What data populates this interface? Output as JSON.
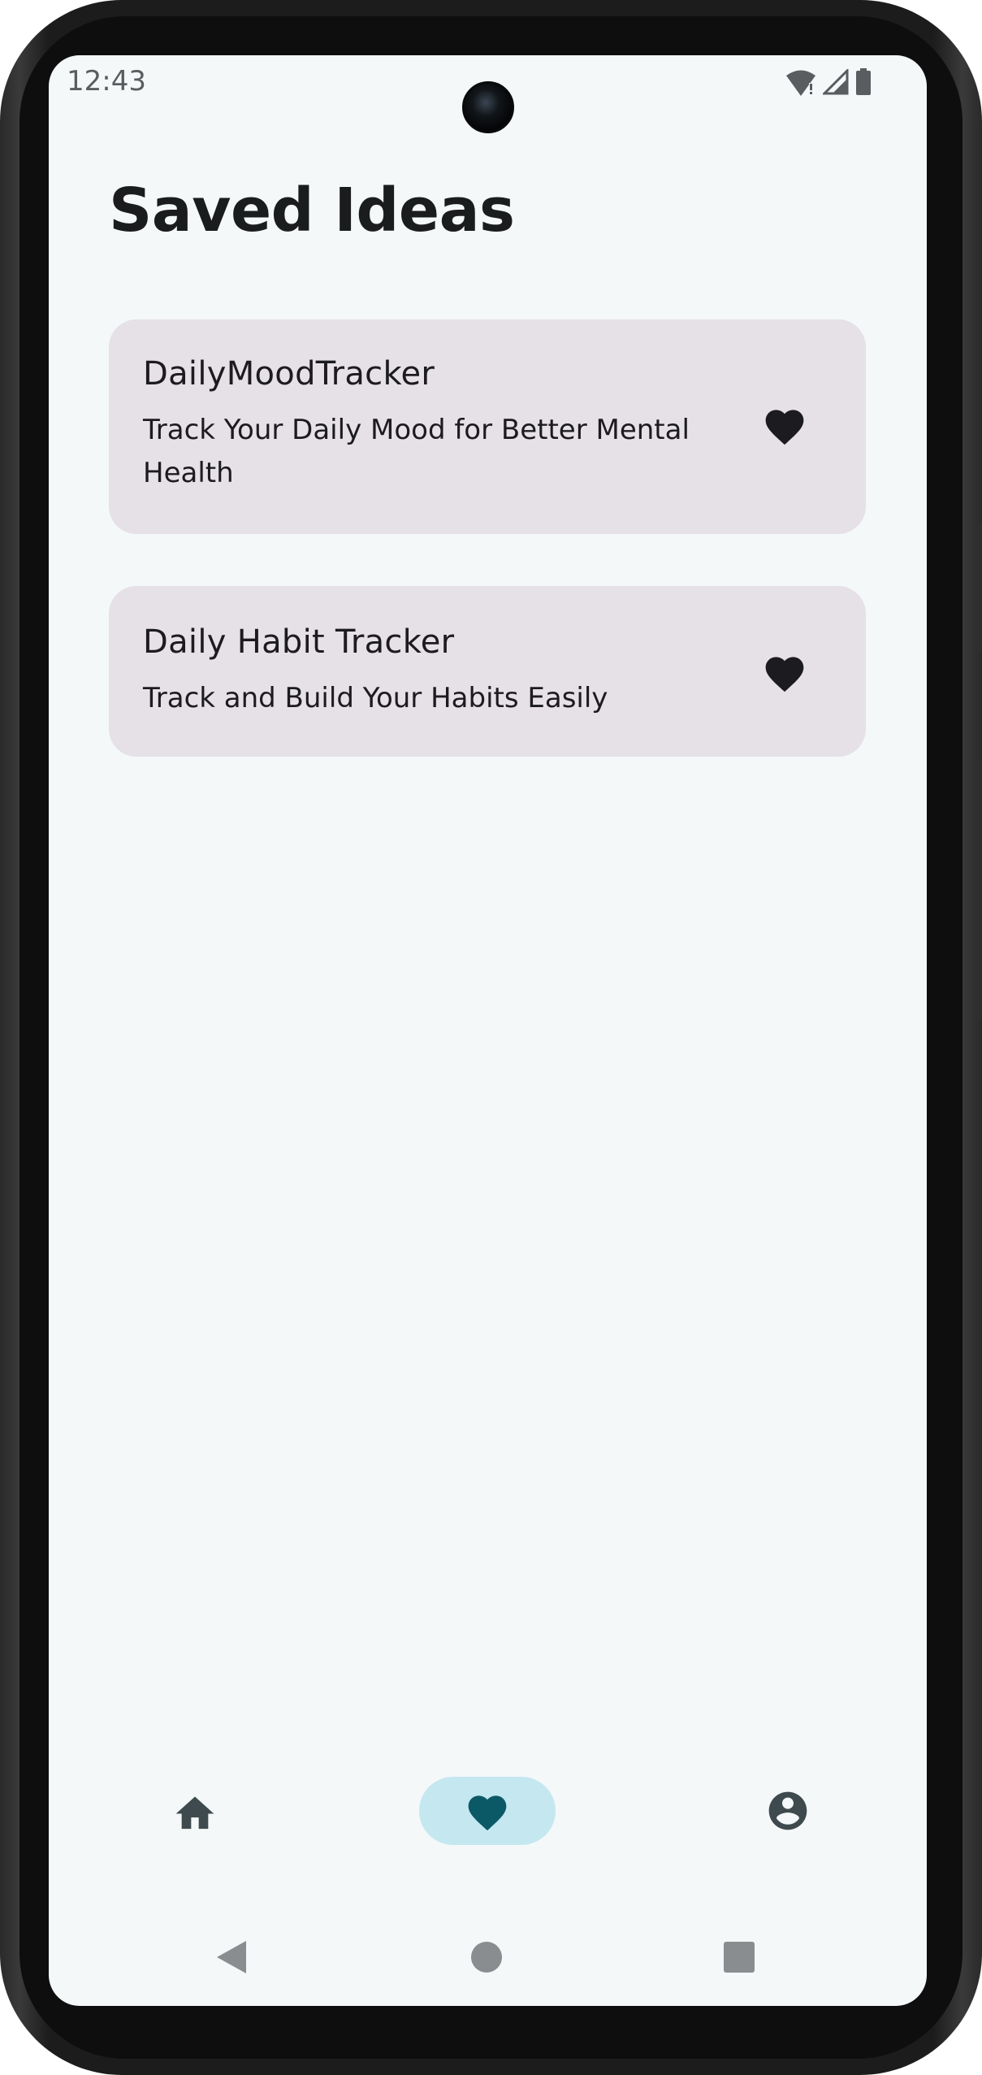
{
  "status_bar": {
    "time": "12:43",
    "icons": [
      "wifi-alert-icon",
      "cellular-signal-icon",
      "battery-icon"
    ]
  },
  "page": {
    "title": "Saved Ideas"
  },
  "ideas": [
    {
      "title": "DailyMoodTracker",
      "subtitle": "Track Your Daily Mood for Better Mental Health",
      "icon": "heart-icon",
      "saved": true
    },
    {
      "title": "Daily Habit Tracker",
      "subtitle": "Track and Build Your Habits Easily",
      "icon": "heart-icon",
      "saved": true
    }
  ],
  "bottom_nav": {
    "items": [
      {
        "icon": "home-icon",
        "selected": false
      },
      {
        "icon": "heart-icon",
        "selected": true
      },
      {
        "icon": "account-circle-icon",
        "selected": false
      }
    ]
  },
  "system_nav": {
    "buttons": [
      "back-icon",
      "home-circle-icon",
      "recents-icon"
    ]
  },
  "colors": {
    "screen_background": "#f4f8f9",
    "card_background": "#e6e0e7",
    "nav_selected_pill": "#c5e7f0",
    "nav_selected_icon": "#0b5966",
    "nav_icon": "#3e4a4d",
    "text_primary": "#1a1c1e"
  }
}
